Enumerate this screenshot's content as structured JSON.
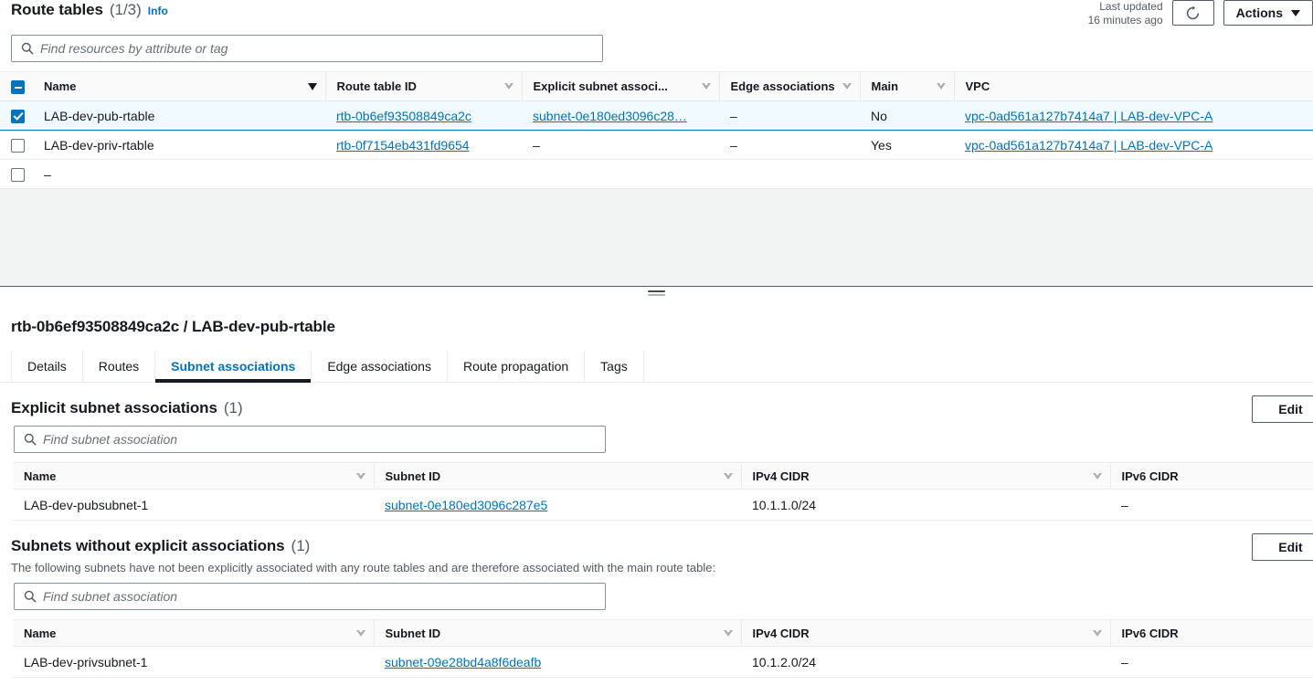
{
  "header": {
    "title": "Route tables",
    "count": "(1/3)",
    "info_label": "Info",
    "last_updated_label": "Last updated",
    "last_updated_value": "16 minutes ago",
    "refresh_icon": "refresh-icon",
    "actions_label": "Actions"
  },
  "search": {
    "placeholder": "Find resources by attribute or tag",
    "value": "",
    "icon": "search-icon"
  },
  "route_tables": {
    "columns": [
      {
        "label": "Name",
        "sort": "desc-active"
      },
      {
        "label": "Route table ID",
        "sort": "inactive"
      },
      {
        "label": "Explicit subnet associ...",
        "sort": "inactive"
      },
      {
        "label": "Edge associations",
        "sort": "inactive"
      },
      {
        "label": "Main",
        "sort": "inactive"
      },
      {
        "label": "VPC",
        "sort": "none"
      }
    ],
    "rows": [
      {
        "selected": true,
        "name": "LAB-dev-pub-rtable",
        "route_table_id": "rtb-0b6ef93508849ca2c",
        "explicit_subnet_associations": "subnet-0e180ed3096c28…",
        "edge_associations": "–",
        "main": "No",
        "vpc": "vpc-0ad561a127b7414a7 | LAB-dev-VPC-A"
      },
      {
        "selected": false,
        "name": "LAB-dev-priv-rtable",
        "route_table_id": "rtb-0f7154eb431fd9654",
        "explicit_subnet_associations": "–",
        "edge_associations": "–",
        "main": "Yes",
        "vpc": "vpc-0ad561a127b7414a7 | LAB-dev-VPC-A"
      },
      {
        "selected": false,
        "name": "–",
        "route_table_id": "",
        "explicit_subnet_associations": "",
        "edge_associations": "",
        "main": "",
        "vpc": ""
      }
    ]
  },
  "detail": {
    "title": "rtb-0b6ef93508849ca2c / LAB-dev-pub-rtable",
    "tabs": [
      {
        "label": "Details",
        "active": false
      },
      {
        "label": "Routes",
        "active": false
      },
      {
        "label": "Subnet associations",
        "active": true
      },
      {
        "label": "Edge associations",
        "active": false
      },
      {
        "label": "Route propagation",
        "active": false
      },
      {
        "label": "Tags",
        "active": false
      }
    ]
  },
  "explicit_section": {
    "title": "Explicit subnet associations",
    "count": "(1)",
    "edit_label": "Edit",
    "search_placeholder": "Find subnet association",
    "search_value": "",
    "columns": [
      "Name",
      "Subnet ID",
      "IPv4 CIDR",
      "IPv6 CIDR"
    ],
    "rows": [
      {
        "name": "LAB-dev-pubsubnet-1",
        "subnet_id": "subnet-0e180ed3096c287e5",
        "ipv4_cidr": "10.1.1.0/24",
        "ipv6_cidr": "–"
      }
    ]
  },
  "implicit_section": {
    "title": "Subnets without explicit associations",
    "count": "(1)",
    "description": "The following subnets have not been explicitly associated with any route tables and are therefore associated with the main route table:",
    "edit_label": "Edit",
    "search_placeholder": "Find subnet association",
    "search_value": "",
    "columns": [
      "Name",
      "Subnet ID",
      "IPv4 CIDR",
      "IPv6 CIDR"
    ],
    "rows": [
      {
        "name": "LAB-dev-privsubnet-1",
        "subnet_id": "subnet-09e28bd4a8f6deafb",
        "ipv4_cidr": "10.1.2.0/24",
        "ipv6_cidr": "–"
      }
    ]
  },
  "colors": {
    "link": "#0073bb",
    "selected_row_bg": "#f1faff",
    "header_bg": "#fafafa",
    "filler_bg": "#f2f3f3"
  }
}
